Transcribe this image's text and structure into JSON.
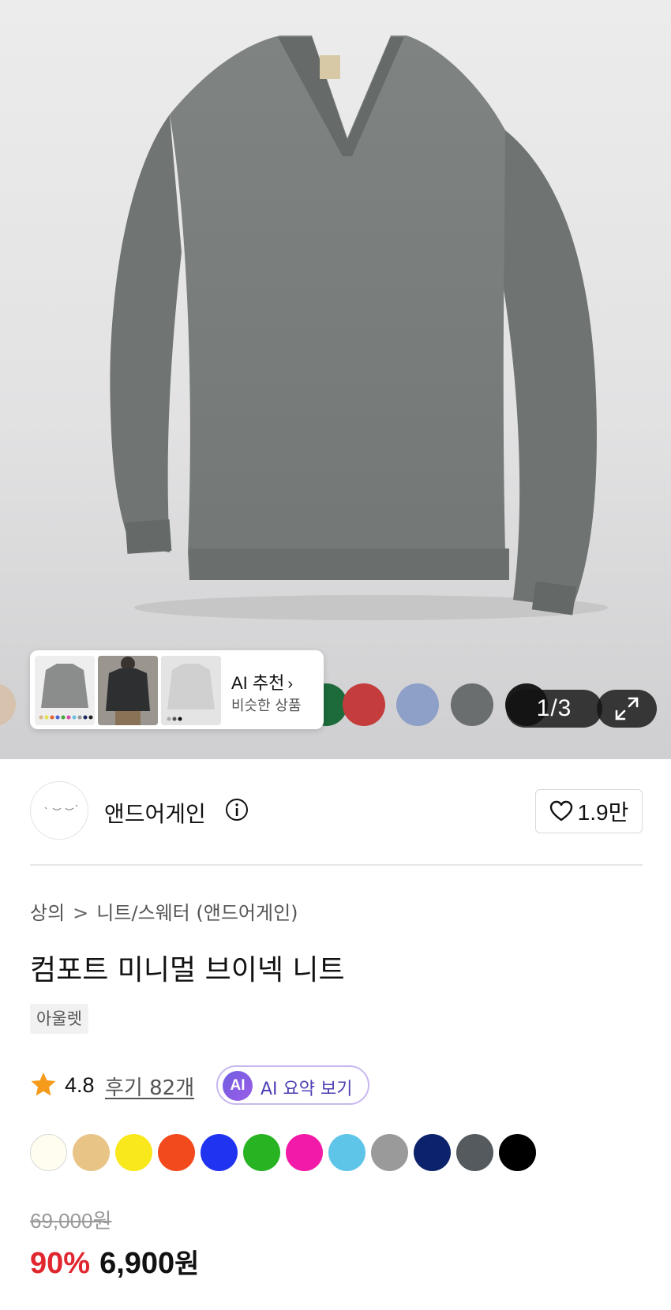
{
  "gallery": {
    "pager_current": "1",
    "pager_total": "3",
    "color_strip": [
      "#d7c2ad",
      "#1d6b3b",
      "#c43c3c",
      "#8ea0c8",
      "#6b6e6e",
      "#1a1a1a"
    ]
  },
  "ai_recommend": {
    "title": "AI 추천",
    "subtitle": "비슷한 상품"
  },
  "brand": {
    "name": "앤드어게인",
    "likes": "1.9만"
  },
  "breadcrumb": {
    "level1": "상의",
    "separator": ">",
    "level2": "니트/스웨터 (앤드어게인)"
  },
  "product": {
    "title": "컴포트 미니멀 브이넥 니트",
    "tag": "아울렛",
    "rating": "4.8",
    "review_link": "후기 82개",
    "ai_badge": "AI",
    "ai_summary_label": "AI 요약 보기",
    "colors": [
      "#fffdf0",
      "#e8c487",
      "#f8e81c",
      "#f24a1d",
      "#1f33f0",
      "#27b322",
      "#f21aa8",
      "#5ec5e8",
      "#9a9a9a",
      "#0c236b",
      "#555a5f",
      "#000000"
    ],
    "original_price": "69,000원",
    "discount": "90%",
    "final_price_number": "6,900",
    "final_price_unit": "원"
  }
}
